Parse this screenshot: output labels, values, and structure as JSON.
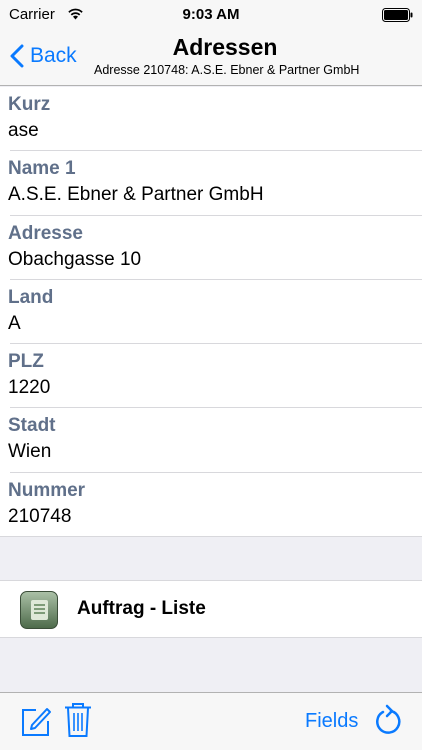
{
  "status_bar": {
    "carrier": "Carrier",
    "time": "9:03 AM"
  },
  "nav": {
    "back_label": "Back",
    "title": "Adressen",
    "subtitle": "Adresse 210748: A.S.E. Ebner & Partner GmbH"
  },
  "fields": [
    {
      "label": "Kurz",
      "value": "ase"
    },
    {
      "label": "Name 1",
      "value": "A.S.E. Ebner & Partner GmbH"
    },
    {
      "label": "Adresse",
      "value": "Obachgasse 10"
    },
    {
      "label": "Land",
      "value": "A"
    },
    {
      "label": "PLZ",
      "value": "1220"
    },
    {
      "label": "Stadt",
      "value": "Wien"
    },
    {
      "label": "Nummer",
      "value": "210748"
    }
  ],
  "action": {
    "label": "Auftrag - Liste",
    "icon": "document-list-icon"
  },
  "toolbar": {
    "fields_label": "Fields",
    "icons": [
      "compose-icon",
      "trash-icon",
      "refresh-icon"
    ]
  },
  "colors": {
    "accent": "#0a7aff",
    "field_label": "#60708a",
    "background": "#efeff4"
  }
}
